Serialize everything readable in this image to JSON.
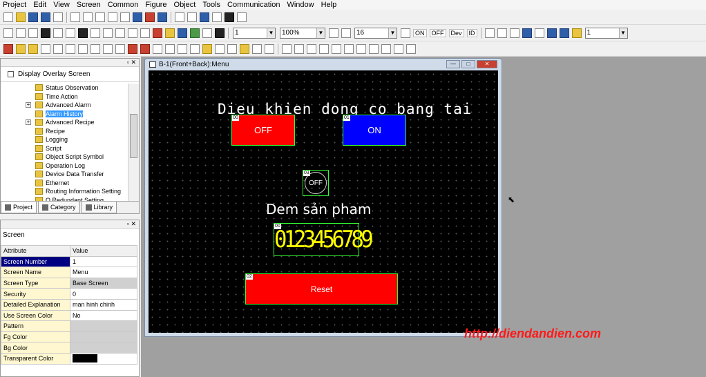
{
  "menu": [
    "Project",
    "Edit",
    "View",
    "Screen",
    "Common",
    "Figure",
    "Object",
    "Tools",
    "Communication",
    "Window",
    "Help"
  ],
  "toolbar": {
    "line_width": "1",
    "zoom": "100%",
    "font_size": "16",
    "on_label": "ON",
    "off_label": "OFF",
    "dev_label": "Dev",
    "id_label": "ID",
    "right_value": "1"
  },
  "tree_panel": {
    "overlay_checkbox": "Display Overlay Screen",
    "items": [
      {
        "label": "Status Observation",
        "expandable": false,
        "selected": false
      },
      {
        "label": "Time Action",
        "expandable": false,
        "selected": false
      },
      {
        "label": "Advanced Alarm",
        "expandable": true,
        "selected": false
      },
      {
        "label": "Alarm History",
        "expandable": false,
        "selected": true
      },
      {
        "label": "Advanced Recipe",
        "expandable": true,
        "selected": false
      },
      {
        "label": "Recipe",
        "expandable": false,
        "selected": false
      },
      {
        "label": "Logging",
        "expandable": false,
        "selected": false
      },
      {
        "label": "Script",
        "expandable": false,
        "selected": false
      },
      {
        "label": "Object Script Symbol",
        "expandable": false,
        "selected": false
      },
      {
        "label": "Operation Log",
        "expandable": false,
        "selected": false
      },
      {
        "label": "Device Data Transfer",
        "expandable": false,
        "selected": false
      },
      {
        "label": "Ethernet",
        "expandable": false,
        "selected": false
      },
      {
        "label": "Routing Information Setting",
        "expandable": false,
        "selected": false
      },
      {
        "label": "Q Redundant Setting",
        "expandable": false,
        "selected": false
      }
    ],
    "tabs": [
      "Project",
      "Category",
      "Library"
    ]
  },
  "property_panel": {
    "title": "Screen",
    "col_attribute": "Attribute",
    "col_value": "Value",
    "rows": [
      {
        "key": "Screen Number",
        "value": "1"
      },
      {
        "key": "Screen Name",
        "value": "Menu"
      },
      {
        "key": "Screen Type",
        "value": "Base Screen"
      },
      {
        "key": "Security",
        "value": "0"
      },
      {
        "key": "Detailed Explanation",
        "value": "man hinh chinh"
      },
      {
        "key": "Use Screen Color",
        "value": "No"
      },
      {
        "key": "Pattern",
        "value": ""
      },
      {
        "key": "Fg Color",
        "value": ""
      },
      {
        "key": "Bg Color",
        "value": ""
      },
      {
        "key": "Transparent Color",
        "value": ""
      }
    ]
  },
  "editor_window": {
    "title": "B-1(Front+Back):Menu",
    "hmi_title": "Dieu khien dong co bang tai",
    "off_button": {
      "id": "00",
      "label": "OFF"
    },
    "on_button": {
      "id": "01",
      "label": "ON"
    },
    "lamp": {
      "id": "03",
      "label": "OFF"
    },
    "counter_label": "Dem sản pham",
    "counter": {
      "id": "00",
      "value": "0123456789"
    },
    "reset_button": {
      "id": "02",
      "label": "Reset"
    }
  },
  "watermark": "http://diendandien.com",
  "colors": {
    "off_red": "#ff0000",
    "on_blue": "#0000ff",
    "frame_green": "#33ff33",
    "counter_yellow": "#ffff00"
  }
}
